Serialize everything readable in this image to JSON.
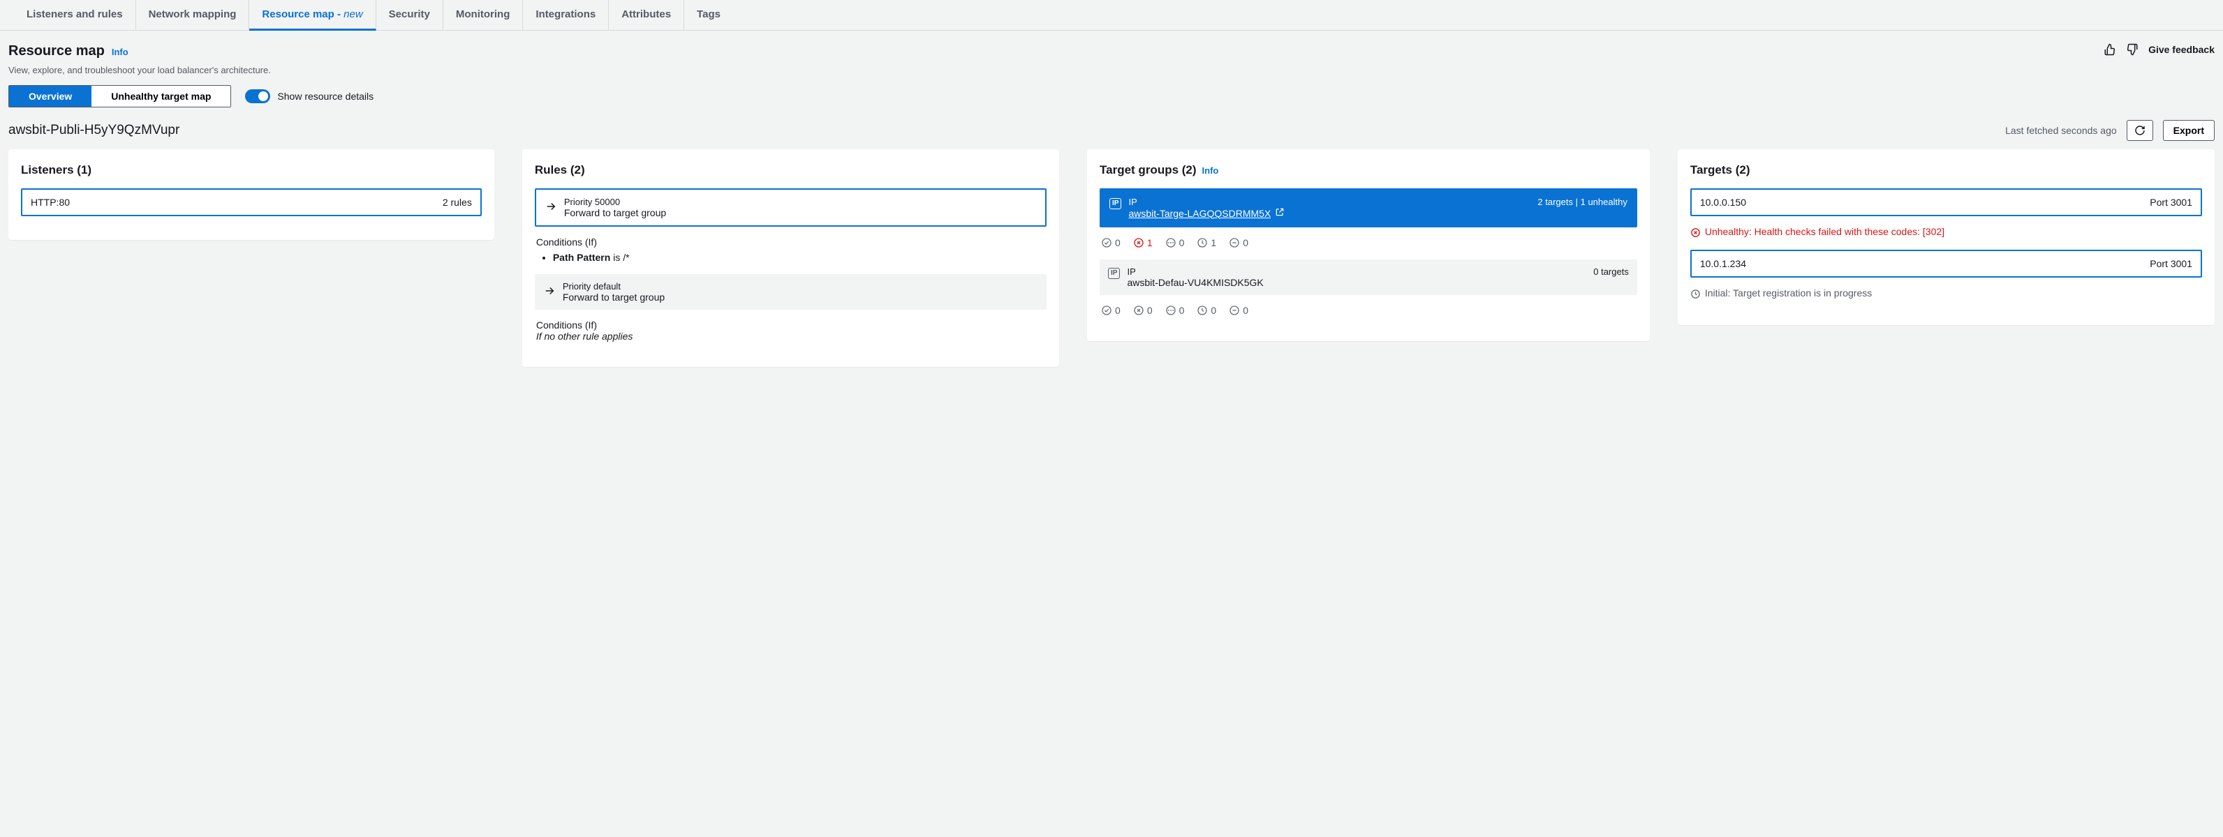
{
  "tabs": {
    "listeners": "Listeners and rules",
    "network": "Network mapping",
    "resource_map": "Resource map - ",
    "resource_map_new": "new",
    "security": "Security",
    "monitoring": "Monitoring",
    "integrations": "Integrations",
    "attributes": "Attributes",
    "tags": "Tags"
  },
  "header": {
    "title": "Resource map",
    "info": "Info",
    "subtitle": "View, explore, and troubleshoot your load balancer's architecture.",
    "feedback": "Give feedback"
  },
  "controls": {
    "overview": "Overview",
    "unhealthy": "Unhealthy target map",
    "toggle_label": "Show resource details"
  },
  "lb": {
    "name": "awsbit-Publi-H5yY9QzMVupr",
    "fetched": "Last fetched seconds ago",
    "export": "Export"
  },
  "cols": {
    "listeners": "Listeners (1)",
    "rules": "Rules (2)",
    "target_groups": "Target groups (2)",
    "targets": "Targets (2)"
  },
  "listener": {
    "name": "HTTP:80",
    "count": "2 rules"
  },
  "rules": {
    "p1_priority": "Priority 50000",
    "p1_action": "Forward to target group",
    "p1_cond_title": "Conditions (If)",
    "p1_cond_prefix": "Path Pattern",
    "p1_cond_suffix": " is /*",
    "p2_priority": "Priority default",
    "p2_action": "Forward to target group",
    "p2_cond_title": "Conditions (If)",
    "p2_cond_text": "If no other rule applies"
  },
  "tg": {
    "ip_label": "IP",
    "tg1_summary": "2 targets | 1 unhealthy",
    "tg1_name": "awsbit-Targe-LAGQQSDRMM5X",
    "tg1_healthy": "0",
    "tg1_unhealthy": "1",
    "tg1_unused": "0",
    "tg1_initial": "1",
    "tg1_draining": "0",
    "tg2_summary": "0 targets",
    "tg2_name": "awsbit-Defau-VU4KMISDK5GK",
    "tg2_healthy": "0",
    "tg2_unhealthy": "0",
    "tg2_unused": "0",
    "tg2_initial": "0",
    "tg2_draining": "0"
  },
  "targets": {
    "t1_ip": "10.0.0.150",
    "t1_port": "Port 3001",
    "t1_status": "Unhealthy: Health checks failed with these codes: [302]",
    "t2_ip": "10.0.1.234",
    "t2_port": "Port 3001",
    "t2_status": "Initial: Target registration is in progress"
  }
}
